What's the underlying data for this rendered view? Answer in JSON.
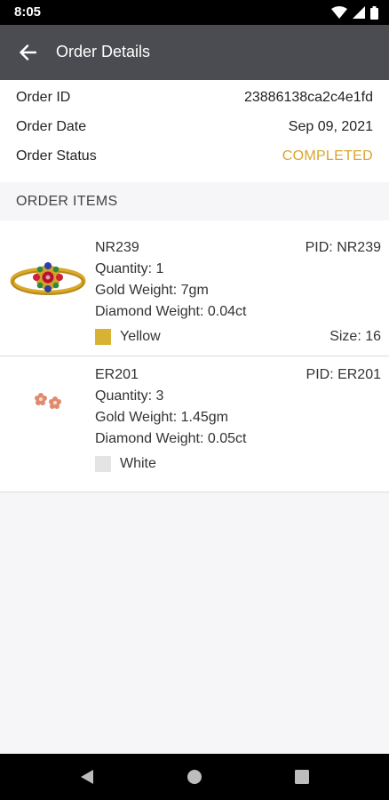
{
  "status_bar": {
    "time": "8:05",
    "icons": [
      "wifi-icon",
      "signal-icon",
      "battery-icon"
    ]
  },
  "app_bar": {
    "title": "Order Details",
    "back_icon": "arrow-left-icon"
  },
  "order": {
    "id_label": "Order ID",
    "id_value": "23886138ca2c4e1fd",
    "date_label": "Order Date",
    "date_value": "Sep 09, 2021",
    "status_label": "Order Status",
    "status_value": "COMPLETED"
  },
  "colors": {
    "app_bar": "#4a4c52",
    "status_completed": "#d8a52c",
    "swatch_yellow": "#d8b333",
    "swatch_white": "#e4e4e4"
  },
  "items_header": "ORDER ITEMS",
  "items": [
    {
      "name": "NR239",
      "pid": "PID: NR239",
      "quantity": "Quantity: 1",
      "gold_weight": "Gold Weight: 7gm",
      "diamond_weight": "Diamond Weight: 0.04ct",
      "color": "Yellow",
      "size": "Size: 16",
      "image": "gold-ring-image"
    },
    {
      "name": "ER201",
      "pid": "PID: ER201",
      "quantity": "Quantity: 3",
      "gold_weight": "Gold Weight: 1.45gm",
      "diamond_weight": "Diamond Weight: 0.05ct",
      "color": "White",
      "image": "earrings-image"
    }
  ],
  "nav": {
    "back": "triangle-back-icon",
    "home": "circle-home-icon",
    "recents": "square-recents-icon"
  }
}
